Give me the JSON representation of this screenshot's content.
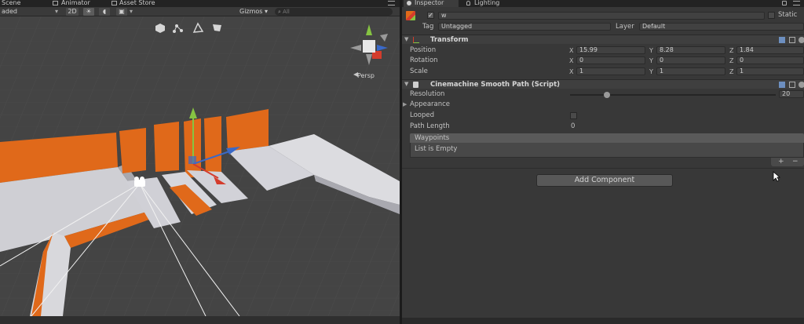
{
  "scene": {
    "tabs": [
      "Scene",
      "Animator",
      "Asset Store"
    ],
    "toolbar": {
      "shading_mode": "aded",
      "mode_2d": "2D",
      "gizmos_label": "Gizmos",
      "search_placeholder": "All"
    },
    "persp_label": "Persp"
  },
  "inspector": {
    "tabs": [
      "Inspector",
      "Lighting"
    ],
    "object": {
      "name": "w",
      "static_label": "Static",
      "tag_label": "Tag",
      "tag_value": "Untagged",
      "layer_label": "Layer",
      "layer_value": "Default"
    },
    "transform": {
      "title": "Transform",
      "position_label": "Position",
      "rotation_label": "Rotation",
      "scale_label": "Scale",
      "position": {
        "x": "15.99",
        "y": "8.28",
        "z": "1.84"
      },
      "rotation": {
        "x": "0",
        "y": "0",
        "z": "0"
      },
      "scale": {
        "x": "1",
        "y": "1",
        "z": "1"
      }
    },
    "path": {
      "title": "Cinemachine Smooth Path (Script)",
      "resolution_label": "Resolution",
      "resolution_value": "20",
      "resolution_slider": 0.18,
      "appearance_label": "Appearance",
      "looped_label": "Looped",
      "looped": false,
      "path_length_label": "Path Length",
      "path_length_value": "0",
      "waypoints_label": "Waypoints",
      "list_empty_label": "List is Empty",
      "add_symbol": "+",
      "remove_symbol": "−"
    },
    "add_component_label": "Add Component"
  },
  "colors": {
    "accent_orange": "#e0691a",
    "wall_face": "#d9d9dd",
    "viewport_bg": "#454545",
    "panel_bg": "#383838",
    "axis_x": "#d43c2c",
    "axis_y": "#86c442",
    "axis_z": "#3a69c8"
  }
}
